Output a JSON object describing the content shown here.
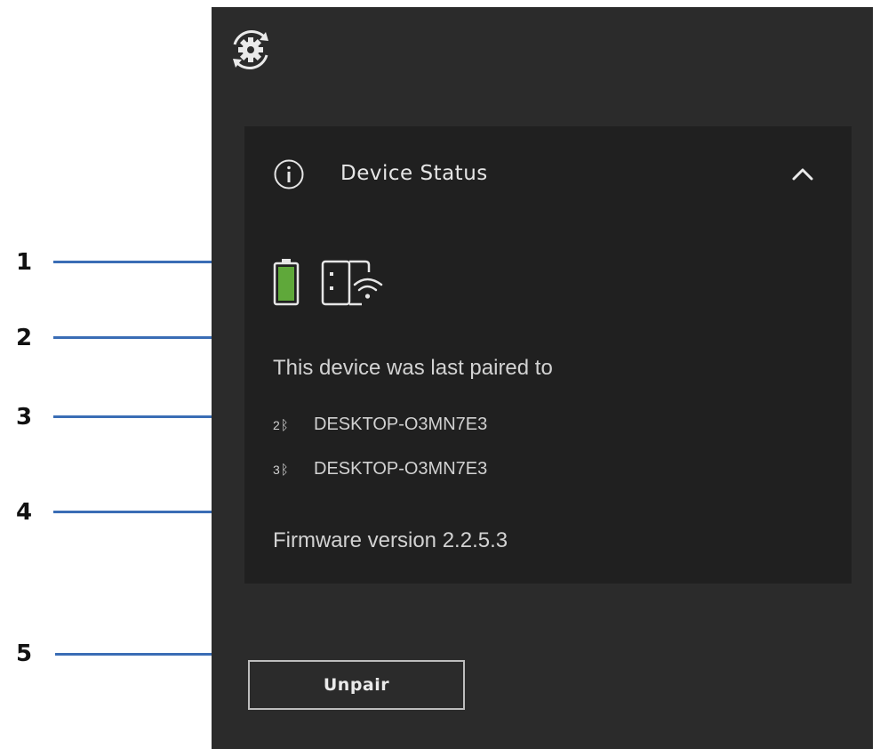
{
  "callouts": [
    "1",
    "2",
    "3",
    "4",
    "5"
  ],
  "header": {
    "sync_icon": "sync-gear-icon"
  },
  "device_status": {
    "title": "Device Status",
    "info_icon": "info-icon",
    "collapse_icon": "chevron-up-icon",
    "battery_icon": "battery-icon",
    "battery_color": "#5fa83a",
    "receiver_icon": "wireless-receiver-icon",
    "paired_label": "This device was last paired to",
    "paired_devices": [
      {
        "slot": "2",
        "icon": "bluetooth-icon",
        "name": "DESKTOP-O3MN7E3"
      },
      {
        "slot": "3",
        "icon": "bluetooth-icon",
        "name": "DESKTOP-O3MN7E3"
      }
    ],
    "firmware": "Firmware version 2.2.5.3"
  },
  "actions": {
    "unpair_label": "Unpair"
  }
}
